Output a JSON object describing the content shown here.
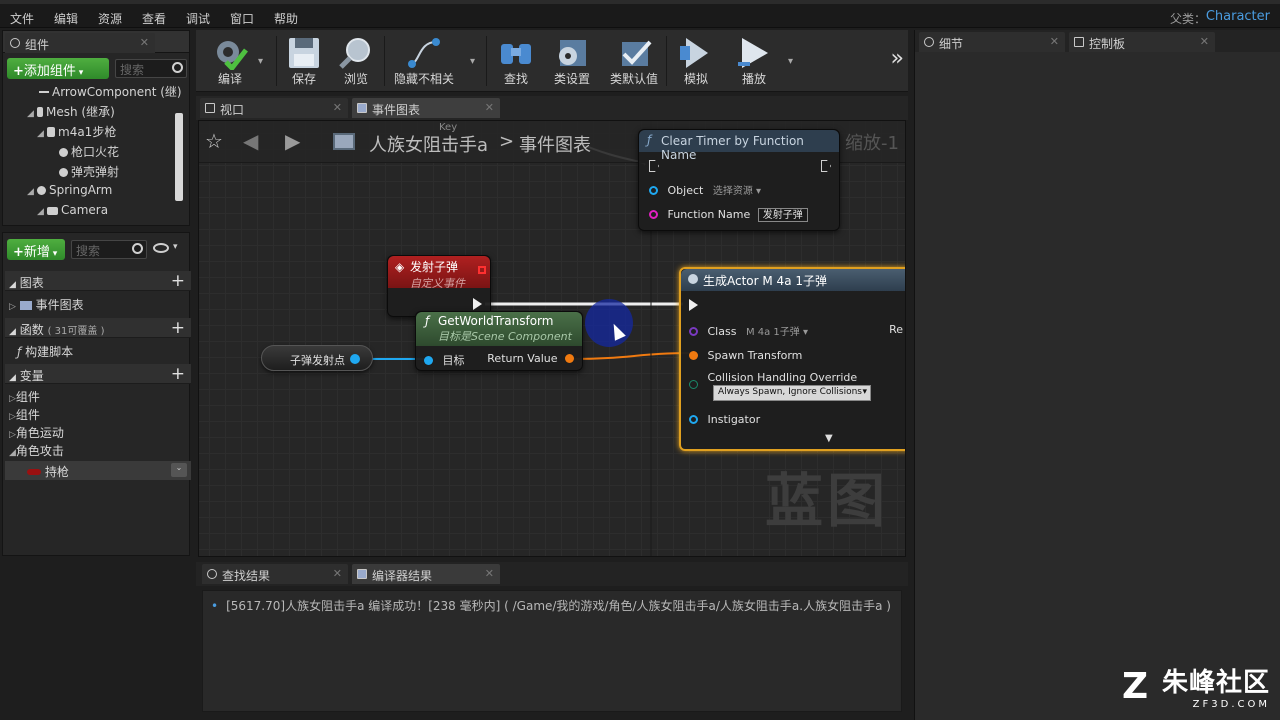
{
  "menu": {
    "items": [
      "文件",
      "编辑",
      "资源",
      "查看",
      "调试",
      "窗口",
      "帮助"
    ],
    "parent_label": "父类：",
    "parent_value": "Character"
  },
  "components_panel": {
    "tab_label": "组件",
    "add_button": "添加组件",
    "search_placeholder": "搜索",
    "tree": [
      {
        "label": "ArrowComponent (继)"
      },
      {
        "label": "Mesh (继承)"
      },
      {
        "label": "m4a1步枪"
      },
      {
        "label": "枪口火花"
      },
      {
        "label": "弹壳弹射"
      },
      {
        "label": "SpringArm"
      },
      {
        "label": "Camera"
      }
    ]
  },
  "my_blueprint": {
    "new_button": "新增",
    "search_placeholder": "搜索",
    "sections": {
      "graphs": "图表",
      "event_graph": "事件图表",
      "functions": "函数",
      "functions_count": "( 31可覆盖 )",
      "construction_script": "构建脚本",
      "variables": "变量",
      "var_groups": [
        "组件",
        "组件",
        "角色运动",
        "角色攻击"
      ],
      "var_item": "持枪"
    }
  },
  "toolbar": {
    "buttons": [
      "编译",
      "保存",
      "浏览",
      "隐藏不相关",
      "查找",
      "类设置",
      "类默认值",
      "模拟",
      "播放"
    ],
    "more": "»"
  },
  "graph_tabs": {
    "viewport": "视口",
    "event_graph": "事件图表"
  },
  "graph": {
    "breadcrumb_root": "人族女阻击手a",
    "breadcrumb_sep": ">",
    "breadcrumb_leaf": "事件图表",
    "zoom": "缩放-1",
    "key_fragment": "Key",
    "watermark": "蓝图",
    "nodes": {
      "clear_timer": {
        "title": "Clear Timer by Function Name",
        "object_label": "Object",
        "object_value": "选择资源",
        "function_name_label": "Function Name",
        "function_name_value": "发射子弹"
      },
      "custom_event": {
        "title": "发射子弹",
        "subtitle": "自定义事件"
      },
      "get_world_transform": {
        "title": "GetWorldTransform",
        "subtitle": "目标是Scene Component",
        "target_label": "目标",
        "return_label": "Return Value"
      },
      "variable_getter": {
        "label": "子弹发射点"
      },
      "spawn_actor": {
        "title": "生成Actor M 4a 1子弹",
        "class_label": "Class",
        "class_value": "M 4a 1子弹",
        "return_fragment": "Re",
        "spawn_transform": "Spawn Transform",
        "collision_label": "Collision Handling Override",
        "collision_value": "Always Spawn, Ignore Collisions",
        "instigator": "Instigator"
      }
    }
  },
  "bottom": {
    "find_results_tab": "查找结果",
    "compiler_results_tab": "编译器结果",
    "log": "[5617.70]人族女阻击手a 编译成功！[238 毫秒内] ( /Game/我的游戏/角色/人族女阻击手a/人族女阻击手a.人族女阻击手a )"
  },
  "right_panel": {
    "details_tab": "细节",
    "palette_tab": "控制板"
  },
  "branding": {
    "name": "朱峰社区",
    "url": "ZF3D.COM",
    "mark": "Z"
  },
  "colors": {
    "exec": "#f0f0f0",
    "object_pin": "#1fa8f0",
    "transform_pin": "#f07a10",
    "class_pin": "#7a3ac0",
    "string_pin": "#e020c0",
    "custom_event_header": "#8b1b1b",
    "function_header": "#3d5a3a",
    "spawn_selected_border": "#e0a020"
  }
}
